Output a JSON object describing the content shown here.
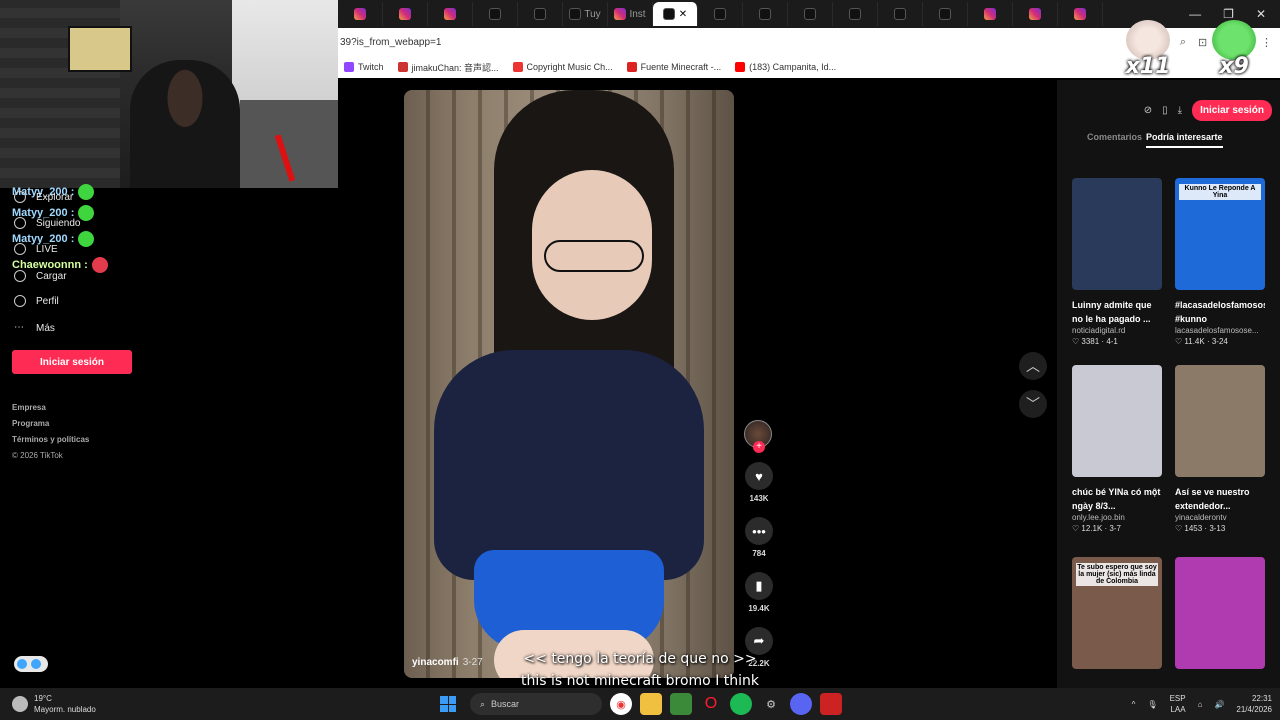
{
  "browser": {
    "url": "39?is_from_webapp=1",
    "tabs": [
      {
        "icon": "instagram",
        "label": ""
      },
      {
        "icon": "instagram",
        "label": ""
      },
      {
        "icon": "instagram",
        "label": ""
      },
      {
        "icon": "tiktok",
        "label": ""
      },
      {
        "icon": "tiktok",
        "label": ""
      },
      {
        "icon": "tiktok",
        "label": "Tuy"
      },
      {
        "icon": "instagram",
        "label": "Inst"
      },
      {
        "icon": "tiktok",
        "label": "",
        "active": true
      },
      {
        "icon": "tiktok",
        "label": ""
      },
      {
        "icon": "tiktok",
        "label": ""
      },
      {
        "icon": "tiktok",
        "label": ""
      },
      {
        "icon": "tiktok",
        "label": ""
      },
      {
        "icon": "tiktok",
        "label": ""
      },
      {
        "icon": "tiktok",
        "label": ""
      },
      {
        "icon": "instagram",
        "label": ""
      },
      {
        "icon": "instagram",
        "label": ""
      },
      {
        "icon": "instagram",
        "label": ""
      }
    ],
    "bookmarks": [
      "Twitch",
      "jimakuChan: 音声認...",
      "Copyright Music Ch...",
      "Fuente Minecraft -...",
      "(183) Campanita, Id..."
    ],
    "bookmark_colors": [
      "#9146ff",
      "#c33",
      "#e33",
      "#d22",
      "#f00"
    ]
  },
  "overlay": {
    "badge_left_count": "x11",
    "badge_right_count": "x9"
  },
  "sidebar": {
    "nav": [
      {
        "label": "Explorar",
        "icon": "compass-icon"
      },
      {
        "label": "Siguiendo",
        "icon": "following-icon"
      },
      {
        "label": "LIVE",
        "icon": "live-icon"
      },
      {
        "label": "Cargar",
        "icon": "upload-icon"
      },
      {
        "label": "Perfil",
        "icon": "profile-icon"
      },
      {
        "label": "Más",
        "icon": "more-icon"
      }
    ],
    "chat": [
      {
        "user": "Matyy_200 :",
        "color": "#9fd9ff"
      },
      {
        "user": "Matyy_200 :",
        "color": "#9fd9ff"
      },
      {
        "user": "Matyy_200 :",
        "color": "#9fd9ff"
      },
      {
        "user": "Chaewoonnn :",
        "color": "#d5ffa0"
      }
    ],
    "login_label": "Iniciar sesión",
    "footer": [
      "Empresa",
      "Programa",
      "Términos y políticas",
      "© 2026 TikTok"
    ]
  },
  "video": {
    "author": "yinacomfi",
    "date": "3-27",
    "likes": "143K",
    "comments": "784",
    "saves": "19.4K",
    "shares": "22.2K"
  },
  "subtitles": {
    "line1": "<< tengo la teoría de que no >>",
    "line2": "this is not minecraft bromo I think"
  },
  "right_panel": {
    "login_label": "Iniciar sesión",
    "tabs": [
      "Comentarios",
      "Podría interesarte"
    ],
    "cards": [
      {
        "title": "Luinny admite que no le ha pagado ...",
        "author": "noticiadigital.rd",
        "likes": "3381",
        "date": "4-1",
        "color": "#2a3a5a"
      },
      {
        "title": "#lacasadelosfamosos #kunno",
        "author": "lacasadelosfamosose...",
        "likes": "11.4K",
        "date": "3-24",
        "color": "#1e6ad8",
        "overlay": "Kunno Le Reponde A Yina"
      },
      {
        "title": "chúc bé YINa có một ngày 8/3...",
        "author": "only.lee.joo.bin",
        "likes": "12.1K",
        "date": "3-7",
        "color": "#c9c9d3"
      },
      {
        "title": "Así se ve nuestro extendedor...",
        "author": "yinacalderontv",
        "likes": "1453",
        "date": "3-13",
        "color": "#8c7a68"
      },
      {
        "title": "",
        "author": "",
        "likes": "",
        "date": "",
        "color": "#7a5a4a",
        "overlay": "Te subo espero que soy la mujer (sic) más linda de Colombia"
      },
      {
        "title": "",
        "author": "",
        "likes": "",
        "date": "",
        "color": "#b03ab0"
      }
    ]
  },
  "taskbar": {
    "temperature": "19°C",
    "weather": "Mayorm. nublado",
    "search_placeholder": "Buscar",
    "lang1": "ESP",
    "lang2": "LAA",
    "time": "22:31",
    "date": "21/4/2026"
  }
}
